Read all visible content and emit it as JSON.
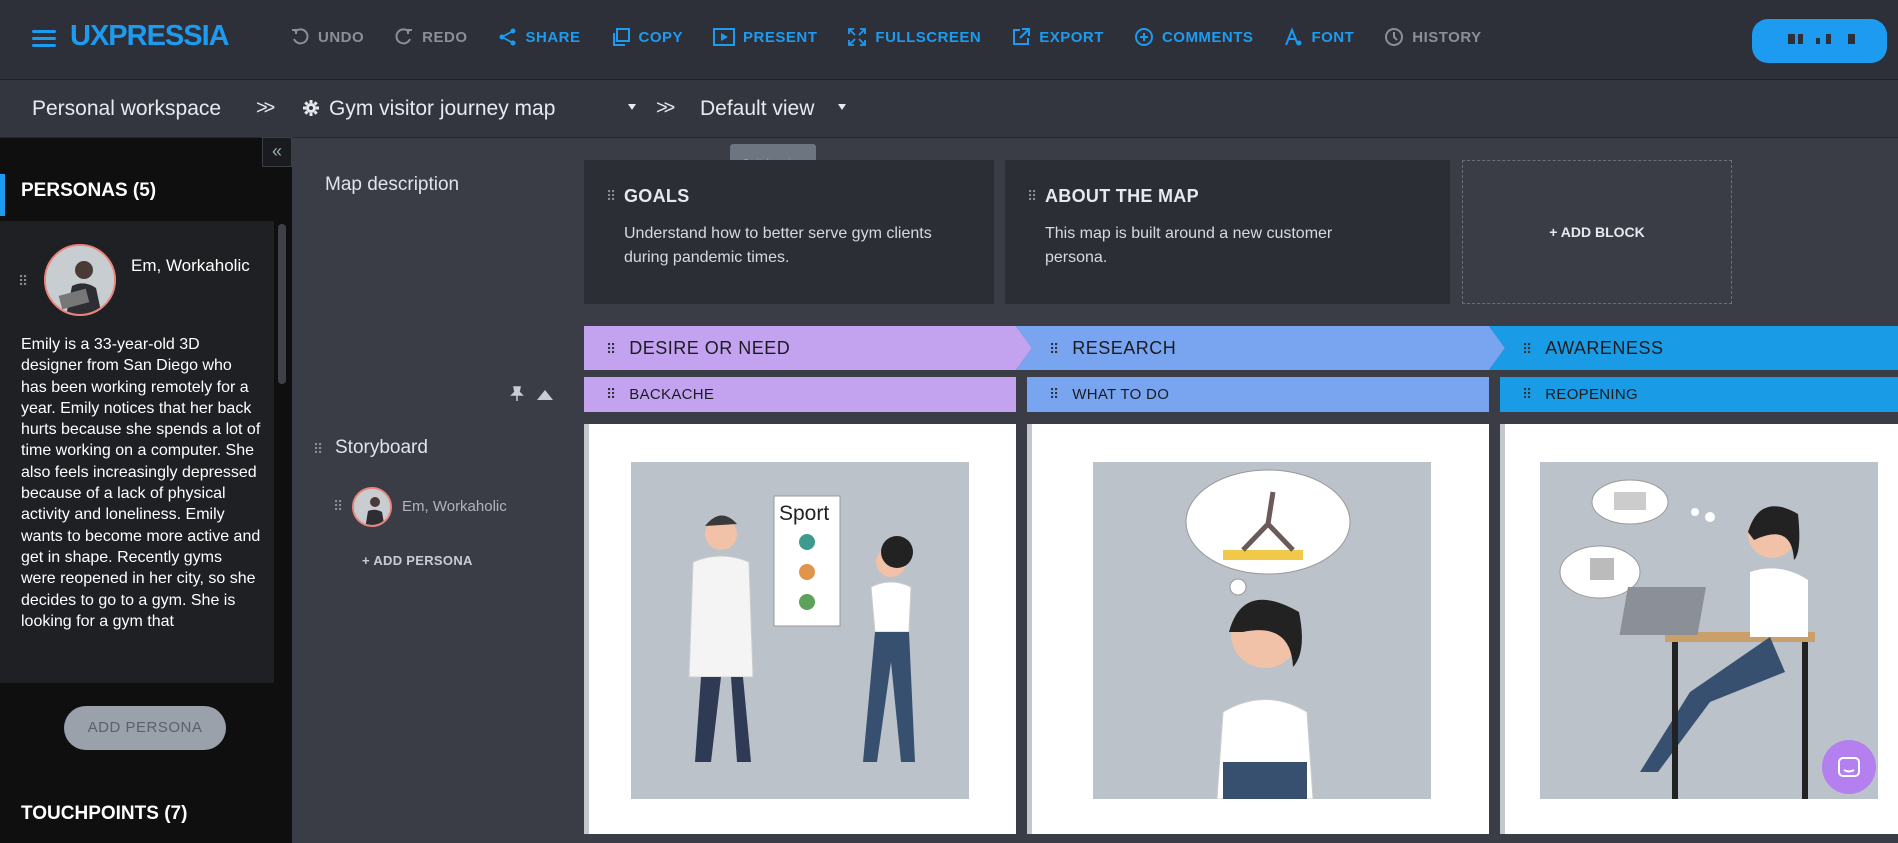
{
  "app": {
    "logo": "UXPRESSIA"
  },
  "toolbar": [
    {
      "label": "UNDO",
      "icon": "undo-icon",
      "enabled": false
    },
    {
      "label": "REDO",
      "icon": "redo-icon",
      "enabled": false
    },
    {
      "label": "SHARE",
      "icon": "share-icon",
      "enabled": true
    },
    {
      "label": "COPY",
      "icon": "copy-icon",
      "enabled": true
    },
    {
      "label": "PRESENT",
      "icon": "present-icon",
      "enabled": true
    },
    {
      "label": "FULLSCREEN",
      "icon": "fullscreen-icon",
      "enabled": true
    },
    {
      "label": "EXPORT",
      "icon": "export-icon",
      "enabled": true
    },
    {
      "label": "COMMENTS",
      "icon": "comments-icon",
      "enabled": true
    },
    {
      "label": "FONT",
      "icon": "font-icon",
      "enabled": true
    },
    {
      "label": "HISTORY",
      "icon": "history-icon",
      "enabled": false
    }
  ],
  "breadcrumb": {
    "workspace": "Personal workspace",
    "map": "Gym visitor journey map",
    "view": "Default view",
    "tooltip": "Switch a view"
  },
  "sidebar": {
    "personas_title": "PERSONAS (5)",
    "persona": {
      "name": "Em, Workaholic",
      "description": "Emily is a 33-year-old 3D designer from San Diego who has been working remotely for a year. Emily notices that her back hurts because she spends a lot of time working on a computer. She also feels increasingly depressed because of a lack of physical activity and loneliness. Emily wants to become more active and get in shape. Recently gyms were reopened in her city, so she decides to go to a gym. She is looking for a gym that"
    },
    "add_persona": "ADD PERSONA",
    "touchpoints_title": "TOUCHPOINTS (7)"
  },
  "map": {
    "description_label": "Map description",
    "blocks": [
      {
        "title": "GOALS",
        "text": "Understand how to better serve gym clients during pandemic times."
      },
      {
        "title": "ABOUT THE MAP",
        "text": "This map is built around a new customer persona."
      }
    ],
    "add_block": "+ ADD BLOCK",
    "storyboard_label": "Storyboard",
    "storyboard_persona": "Em, Workaholic",
    "add_persona": "ADD PERSONA",
    "stages": [
      {
        "title": "DESIRE OR NEED",
        "color": "#c3a3f0",
        "sub": "BACKACHE",
        "sub_color": "#c3a3f0"
      },
      {
        "title": "RESEARCH",
        "color": "#78a4f0",
        "sub": "WHAT TO DO",
        "sub_color": "#78a4f0"
      },
      {
        "title": "AWARENESS",
        "color": "#1a9be6",
        "sub": "REOPENING",
        "sub_color": "#1a9be6"
      }
    ],
    "illustration_text": "Sport"
  },
  "colors": {
    "accent": "#1d9bf0",
    "chat": "#b480ef"
  }
}
